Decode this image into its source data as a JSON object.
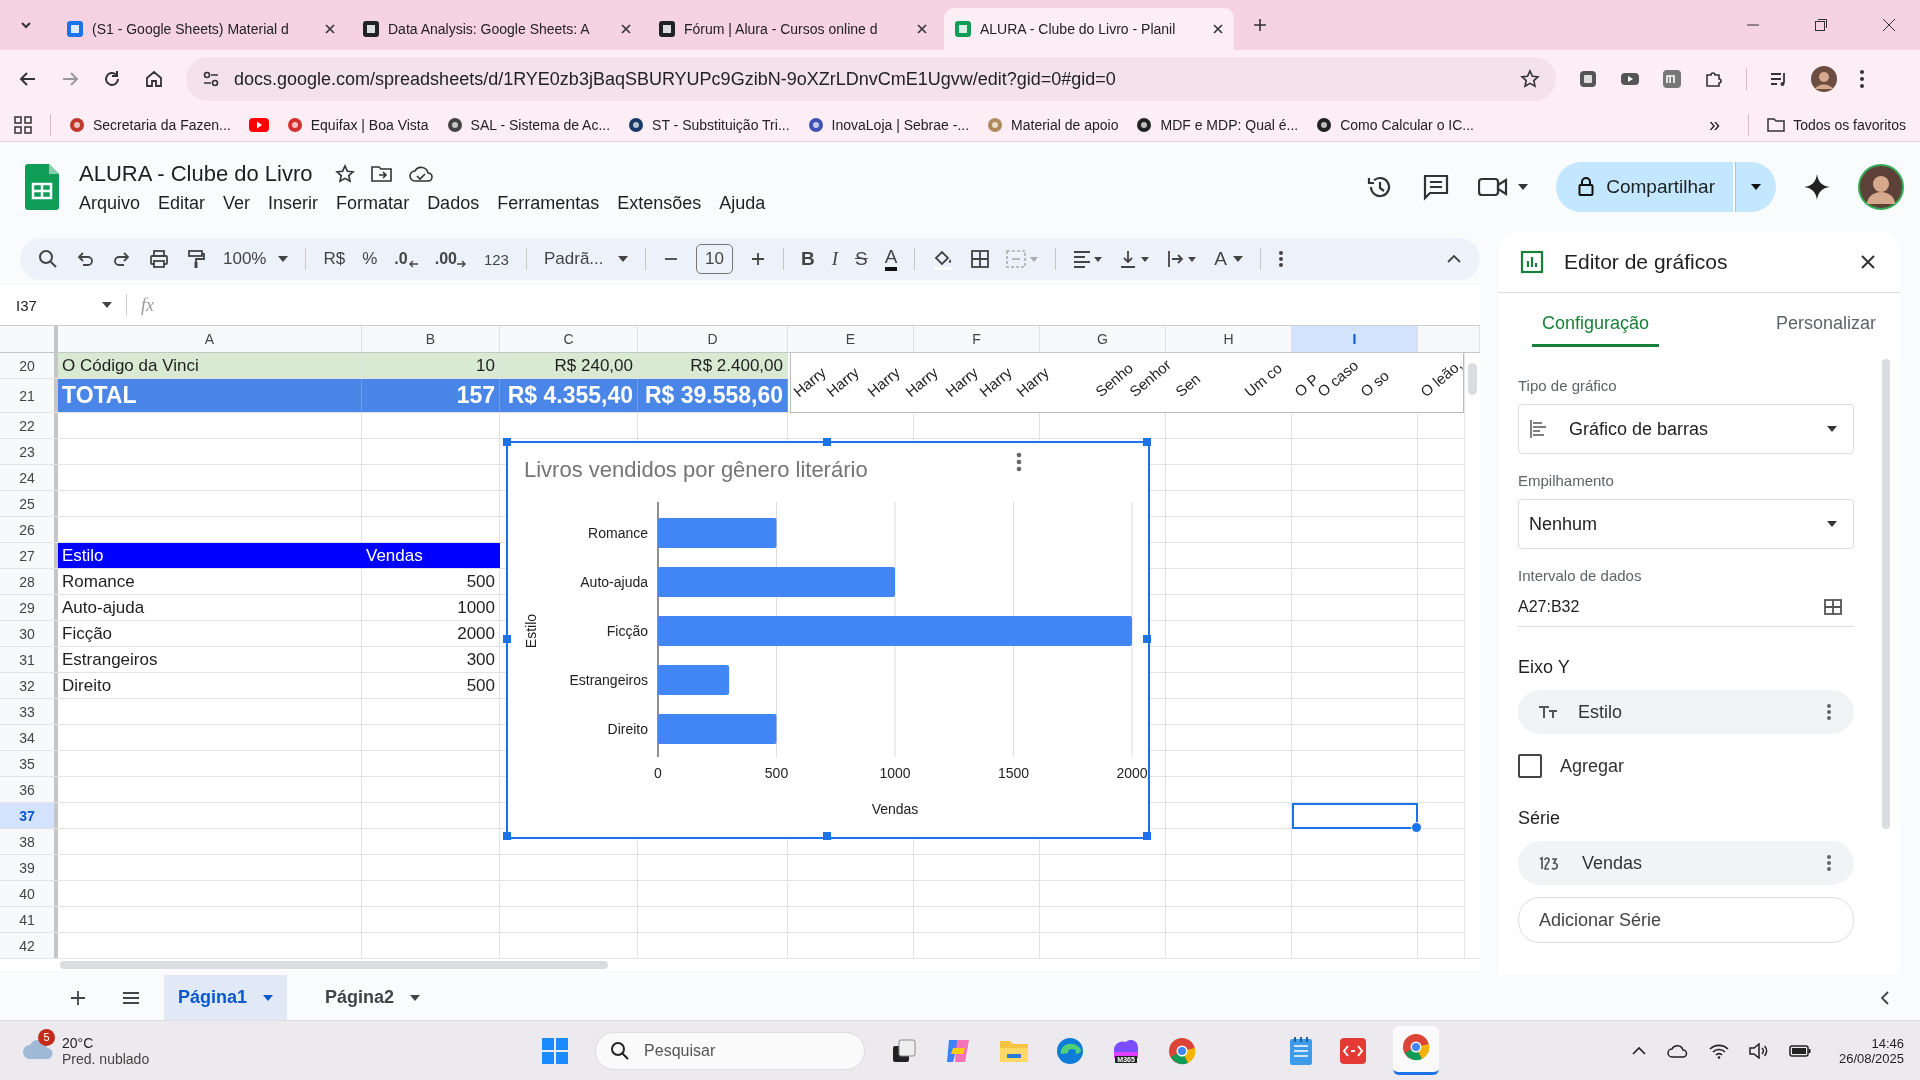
{
  "browser": {
    "tabs": [
      {
        "title": "(S1 - Google Sheets) Material d",
        "selected": false
      },
      {
        "title": "Data Analysis: Google Sheets: A",
        "selected": false
      },
      {
        "title": "Fórum | Alura - Cursos online d",
        "selected": false
      },
      {
        "title": "ALURA - Clube do Livro - Planil",
        "selected": true
      }
    ],
    "url": "docs.google.com/spreadsheets/d/1RYE0zb3jBaqSBURYUPc9GzibN-9oXZrLDnvCmE1Ugvw/edit?gid=0#gid=0",
    "bookmarks": [
      {
        "kind": "link",
        "label": "Secretaria da Fazen..."
      },
      {
        "kind": "icon"
      },
      {
        "kind": "link",
        "label": "Equifax | Boa Vista"
      },
      {
        "kind": "link",
        "label": "SAL - Sistema de Ac..."
      },
      {
        "kind": "link",
        "label": "ST - Substituição Tri..."
      },
      {
        "kind": "link",
        "label": "InovaLoja | Sebrae -..."
      },
      {
        "kind": "link",
        "label": "Material de apoio"
      },
      {
        "kind": "link",
        "label": "MDF e MDP: Qual é..."
      },
      {
        "kind": "link",
        "label": "Como Calcular o IC..."
      }
    ],
    "more": "»",
    "all_bookmarks": "Todos os favoritos"
  },
  "sheets": {
    "title": "ALURA - Clube do Livro",
    "menu": [
      "Arquivo",
      "Editar",
      "Ver",
      "Inserir",
      "Formatar",
      "Dados",
      "Ferramentas",
      "Extensões",
      "Ajuda"
    ],
    "share": "Compartilhar",
    "toolbar": {
      "zoom": "100%",
      "currency": "R$",
      "percent": "%",
      "decrease_decimals": ".0",
      "increase_decimals": ".00",
      "number_format": "123",
      "font": "Padrã...",
      "font_size": "10",
      "format_buttons": [
        {
          "kind": "bold",
          "text": "B"
        },
        {
          "kind": "italic",
          "text": "I"
        },
        {
          "kind": "strike",
          "text": "S"
        },
        {
          "kind": "color",
          "text": "A"
        }
      ],
      "rotate_text": "A"
    },
    "name_box": "I37",
    "formula_label": "fx",
    "columns": [
      {
        "label": "A",
        "selected": false
      },
      {
        "label": "B",
        "selected": false
      },
      {
        "label": "C",
        "selected": false
      },
      {
        "label": "D",
        "selected": false
      },
      {
        "label": "E",
        "selected": false
      },
      {
        "label": "F",
        "selected": false
      },
      {
        "label": "G",
        "selected": false
      },
      {
        "label": "H",
        "selected": false
      },
      {
        "label": "I",
        "selected": true
      }
    ],
    "rows": [
      {
        "number": "20",
        "kind": "highlight",
        "selected": false,
        "cells": [
          {
            "text": "O Código da Vinci",
            "numeric": false
          },
          {
            "text": "10",
            "numeric": true
          },
          {
            "text": "R$ 240,00",
            "numeric": true
          },
          {
            "text": "R$ 2.400,00",
            "numeric": true
          }
        ]
      },
      {
        "number": "21",
        "kind": "total",
        "selected": false,
        "cells": [
          {
            "text": "TOTAL",
            "numeric": false
          },
          {
            "text": "157",
            "numeric": true
          },
          {
            "text": "R$ 4.355,40",
            "numeric": true
          },
          {
            "text": "R$ 39.558,60",
            "numeric": true
          }
        ]
      },
      {
        "number": "22",
        "kind": "plain",
        "selected": false
      },
      {
        "number": "23",
        "kind": "plain",
        "selected": false
      },
      {
        "number": "24",
        "kind": "plain",
        "selected": false
      },
      {
        "number": "25",
        "kind": "plain",
        "selected": false
      },
      {
        "number": "26",
        "kind": "plain",
        "selected": false
      },
      {
        "number": "27",
        "kind": "header",
        "selected": false,
        "cells": [
          {
            "text": "Estilo",
            "numeric": false
          },
          {
            "text": "Vendas",
            "numeric": false
          }
        ]
      },
      {
        "number": "28",
        "kind": "plain",
        "selected": false,
        "cells": [
          {
            "text": "Romance",
            "numeric": false
          },
          {
            "text": "500",
            "numeric": true
          }
        ]
      },
      {
        "number": "29",
        "kind": "plain",
        "selected": false,
        "cells": [
          {
            "text": "Auto-ajuda",
            "numeric": false
          },
          {
            "text": "1000",
            "numeric": true
          }
        ]
      },
      {
        "number": "30",
        "kind": "plain",
        "selected": false,
        "cells": [
          {
            "text": "Ficção",
            "numeric": false
          },
          {
            "text": "2000",
            "numeric": true
          }
        ]
      },
      {
        "number": "31",
        "kind": "plain",
        "selected": false,
        "cells": [
          {
            "text": "Estrangeiros",
            "numeric": false
          },
          {
            "text": "300",
            "numeric": true
          }
        ]
      },
      {
        "number": "32",
        "kind": "plain",
        "selected": false,
        "cells": [
          {
            "text": "Direito",
            "numeric": false
          },
          {
            "text": "500",
            "numeric": true
          }
        ]
      },
      {
        "number": "33",
        "kind": "plain",
        "selected": false
      },
      {
        "number": "34",
        "kind": "plain",
        "selected": false
      },
      {
        "number": "35",
        "kind": "plain",
        "selected": false
      },
      {
        "number": "36",
        "kind": "plain",
        "selected": false
      },
      {
        "number": "37",
        "kind": "plain",
        "selected": true
      },
      {
        "number": "38",
        "kind": "plain",
        "selected": false
      },
      {
        "number": "39",
        "kind": "plain",
        "selected": false
      },
      {
        "number": "40",
        "kind": "plain",
        "selected": false
      },
      {
        "number": "41",
        "kind": "plain",
        "selected": false
      },
      {
        "number": "42",
        "kind": "plain",
        "selected": false
      }
    ],
    "partial_chart": {
      "labels": [
        "Harry",
        "Harry",
        "Harry",
        "Harry",
        "Harry",
        "Harry",
        "Harry",
        "Senho",
        "Senhor",
        "Sen",
        "Um co",
        "O P",
        "O caso",
        "O so",
        "O leão,"
      ]
    },
    "chart": {
      "chart_data": {
        "type": "bar",
        "orientation": "horizontal",
        "title": "Livros vendidos por gênero literário",
        "xlabel": "Vendas",
        "ylabel": "Estilo",
        "categories": [
          "Romance",
          "Auto-ajuda",
          "Ficção",
          "Estrangeiros",
          "Direito"
        ],
        "series": [
          {
            "color": "#4285f4",
            "values": [
              500,
              1000,
              2000,
              300,
              500
            ]
          }
        ],
        "xlim": [
          0,
          2000
        ],
        "grid": true,
        "xticks": [
          {
            "value": 0,
            "label": "0"
          },
          {
            "value": 500,
            "label": "500"
          },
          {
            "value": 1000,
            "label": "1000"
          },
          {
            "value": 1500,
            "label": "1500"
          },
          {
            "value": 2000,
            "label": "2000"
          }
        ]
      }
    },
    "sheet_tabs": [
      {
        "label": "Página1",
        "selected": true
      },
      {
        "label": "Página2",
        "selected": false
      }
    ]
  },
  "editor": {
    "title": "Editor de gráficos",
    "tabs": [
      {
        "label": "Configuração",
        "selected": true
      },
      {
        "label": "Personalizar",
        "selected": false
      }
    ],
    "chart_type": {
      "label": "Tipo de gráfico",
      "value": "Gráfico de barras"
    },
    "stacking": {
      "label": "Empilhamento",
      "value": "Nenhum"
    },
    "range": {
      "label": "Intervalo de dados",
      "value": "A27:B32"
    },
    "y_axis": {
      "heading": "Eixo Y",
      "chip": "Estilo"
    },
    "aggregate": {
      "label": "Agregar",
      "checked": false
    },
    "series": {
      "heading": "Série",
      "chip": "Vendas"
    },
    "add_series": "Adicionar Série"
  },
  "taskbar": {
    "weather": {
      "badge": "5",
      "temp": "20°C",
      "desc": "Pred. nublado"
    },
    "search": {
      "placeholder": "Pesquisar"
    },
    "m365": "M365",
    "time": "14:46",
    "date": "26/08/2025"
  }
}
